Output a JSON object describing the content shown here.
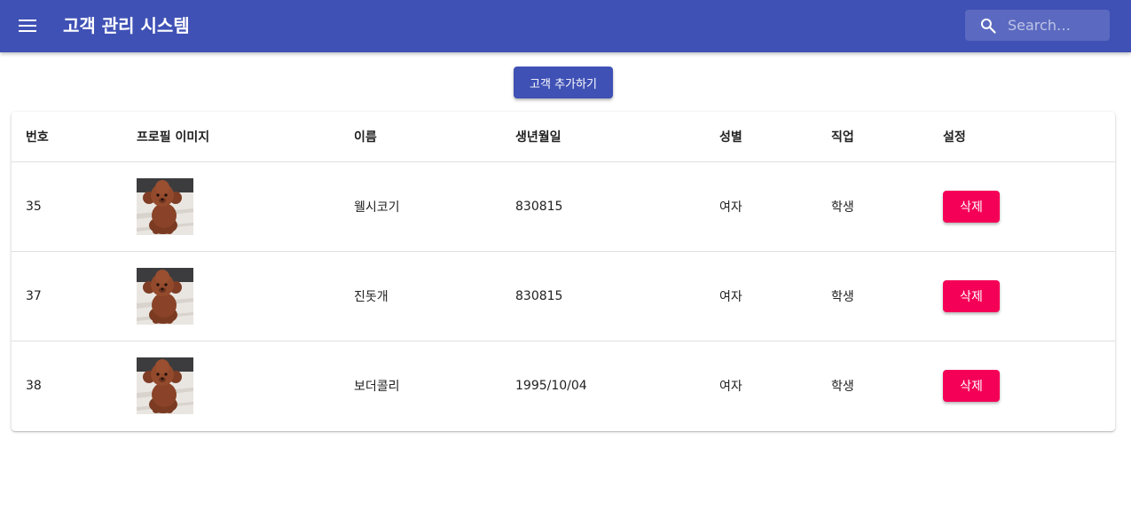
{
  "app": {
    "title": "고객 관리 시스템",
    "menu_icon": "hamburger-menu-icon",
    "primary_color": "#3f51b5",
    "secondary_color": "#f50057"
  },
  "search": {
    "icon": "search-icon",
    "placeholder": "Search…",
    "value": ""
  },
  "actions": {
    "add_customer_label": "고객 추가하기"
  },
  "table": {
    "headers": [
      "번호",
      "프로필 이미지",
      "이름",
      "생년월일",
      "성별",
      "직업",
      "설정"
    ],
    "rows": [
      {
        "id": "35",
        "image": "dog-photo",
        "name": "웰시코기",
        "birthday": "830815",
        "gender": "여자",
        "job": "학생",
        "action_label": "삭제"
      },
      {
        "id": "37",
        "image": "dog-photo",
        "name": "진돗개",
        "birthday": "830815",
        "gender": "여자",
        "job": "학생",
        "action_label": "삭제"
      },
      {
        "id": "38",
        "image": "dog-photo",
        "name": "보더콜리",
        "birthday": "1995/10/04",
        "gender": "여자",
        "job": "학생",
        "action_label": "삭제"
      }
    ]
  }
}
